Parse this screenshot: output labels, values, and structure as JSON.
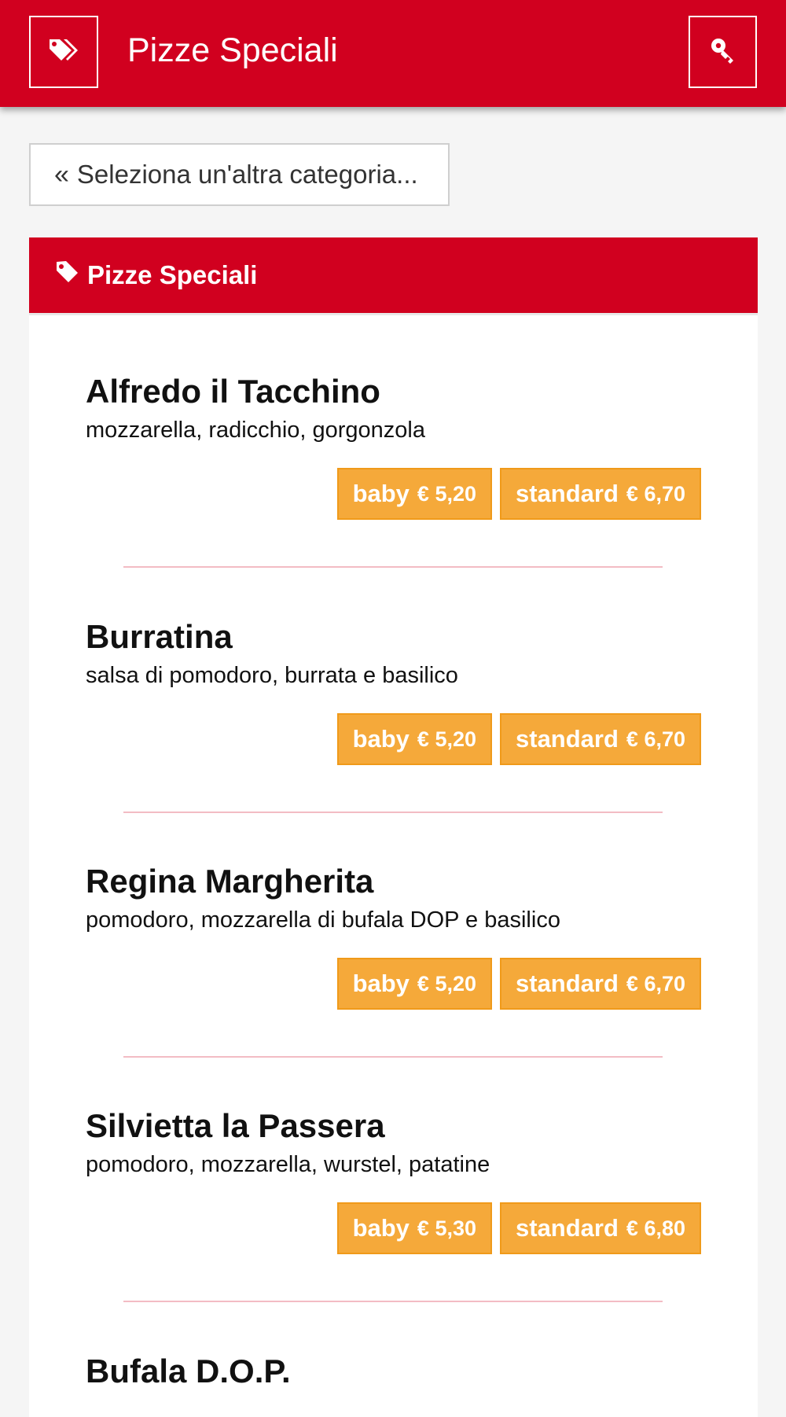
{
  "header": {
    "title": "Pizze Speciali",
    "left_icon": "tags-icon",
    "right_icon": "key-icon",
    "brand_color": "#d1001f"
  },
  "back_button": {
    "chevron": "«",
    "label": "Seleziona un'altra categoria..."
  },
  "panel": {
    "title": "Pizze Speciali",
    "icon": "tag-icon"
  },
  "items": [
    {
      "name": "Alfredo il Tacchino",
      "desc": "mozzarella, radicchio, gorgonzola",
      "prices": [
        {
          "size": "baby",
          "price": "€ 5,20"
        },
        {
          "size": "standard",
          "price": "€ 6,70"
        }
      ]
    },
    {
      "name": "Burratina",
      "desc": "salsa di pomodoro, burrata e basilico",
      "prices": [
        {
          "size": "baby",
          "price": "€ 5,20"
        },
        {
          "size": "standard",
          "price": "€ 6,70"
        }
      ]
    },
    {
      "name": "Regina Margherita",
      "desc": "pomodoro, mozzarella di bufala DOP e basilico",
      "prices": [
        {
          "size": "baby",
          "price": "€ 5,20"
        },
        {
          "size": "standard",
          "price": "€ 6,70"
        }
      ]
    },
    {
      "name": "Silvietta la Passera",
      "desc": "pomodoro, mozzarella, wurstel, patatine",
      "prices": [
        {
          "size": "baby",
          "price": "€ 5,30"
        },
        {
          "size": "standard",
          "price": "€ 6,80"
        }
      ]
    },
    {
      "name": "Bufala D.O.P.",
      "desc": "",
      "prices": []
    }
  ],
  "colors": {
    "price_bg": "#f5a93a",
    "separator": "#f3bcc4"
  }
}
